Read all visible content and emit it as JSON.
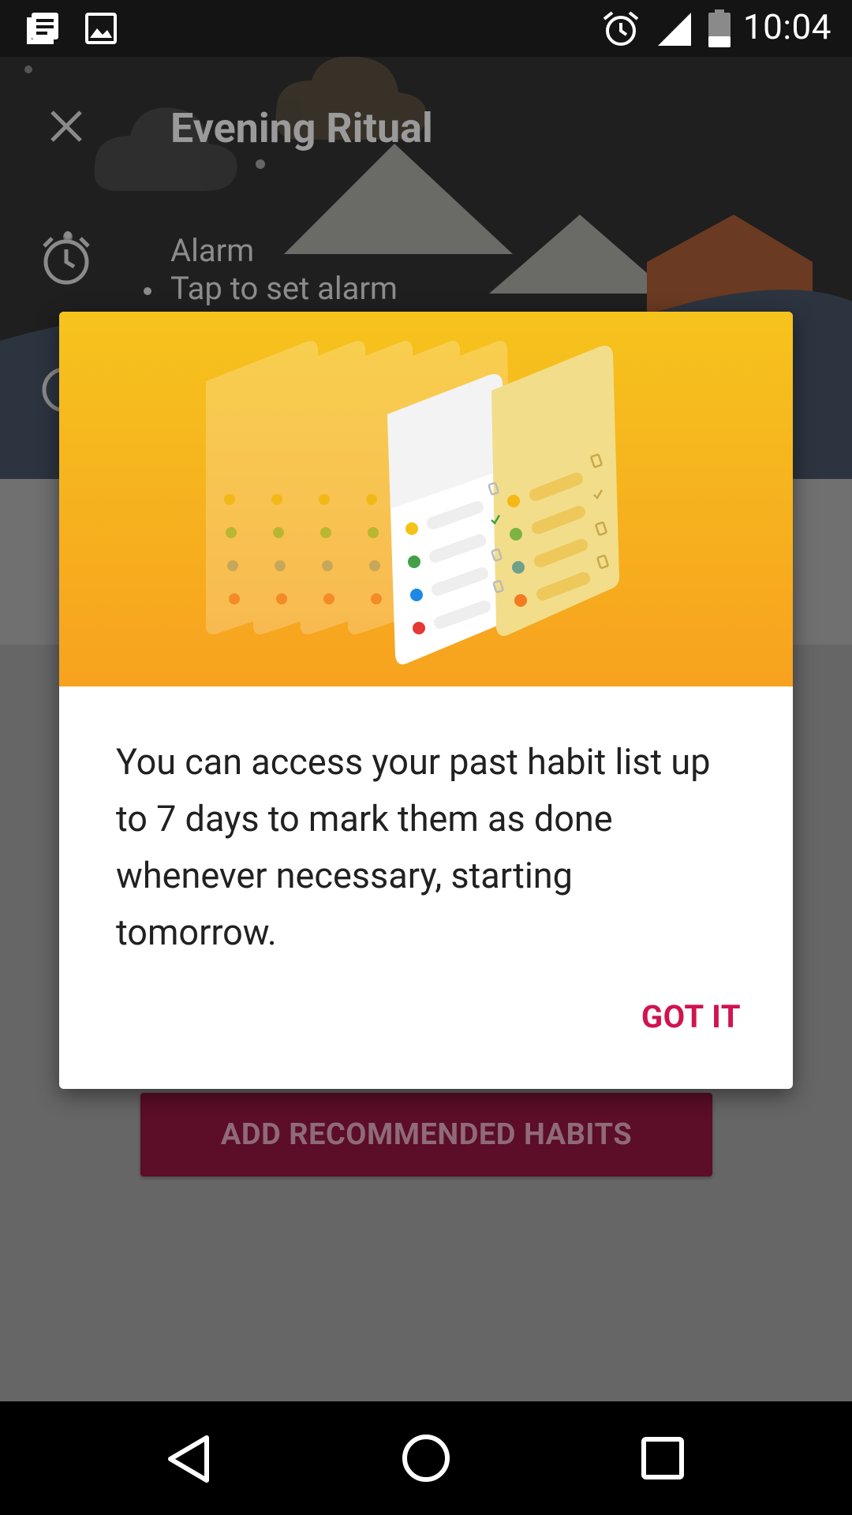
{
  "status_bar": {
    "time": "10:04",
    "left_icons": [
      "notes-icon",
      "image-icon"
    ],
    "right_icons": [
      "alarm-icon",
      "signal-icon",
      "battery-icon"
    ]
  },
  "background": {
    "close_icon": "close-icon",
    "routine_title": "Evening Ritual",
    "alarm_label": "Alarm",
    "alarm_hint": "Tap to set alarm",
    "recommend_button": "ADD RECOMMENDED HABITS"
  },
  "dialog": {
    "message": "You can access your past habit list up to 7 days to mark them as done whenever necessary, starting tomorrow.",
    "confirm_button": "GOT IT",
    "hero_gradient": [
      "#f6c31d",
      "#f7a21f"
    ],
    "accent_color": "#d1134f"
  },
  "nav_bar": {
    "icons": [
      "back-icon",
      "home-icon",
      "recents-icon"
    ]
  }
}
